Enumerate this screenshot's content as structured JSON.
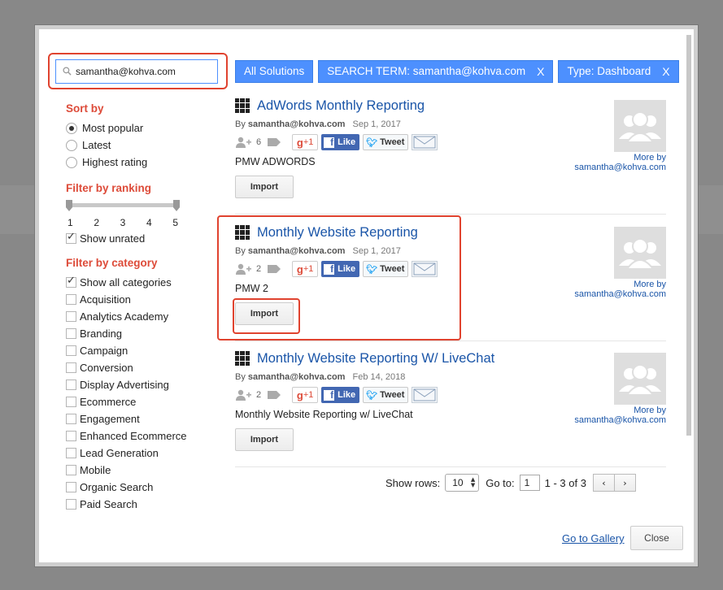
{
  "search": {
    "value": "samantha@kohva.com"
  },
  "sort": {
    "title": "Sort by",
    "options": [
      "Most popular",
      "Latest",
      "Highest rating"
    ],
    "selected": "Most popular"
  },
  "ranking": {
    "title": "Filter by ranking",
    "ticks": [
      "1",
      "2",
      "3",
      "4",
      "5"
    ],
    "show_unrated_label": "Show unrated",
    "show_unrated_checked": true
  },
  "category": {
    "title": "Filter by category",
    "show_all_label": "Show all categories",
    "show_all_checked": true,
    "items": [
      "Acquisition",
      "Analytics Academy",
      "Branding",
      "Campaign",
      "Conversion",
      "Display Advertising",
      "Ecommerce",
      "Engagement",
      "Enhanced Ecommerce",
      "Lead Generation",
      "Mobile",
      "Organic Search",
      "Paid Search"
    ]
  },
  "chips": [
    {
      "label": "All Solutions",
      "removable": false
    },
    {
      "label": "SEARCH TERM: samantha@kohva.com",
      "removable": true,
      "x": "X"
    },
    {
      "label": "Type: Dashboard",
      "removable": true,
      "x": "X"
    }
  ],
  "results": [
    {
      "title": "AdWords Monthly Reporting",
      "by_prefix": "By",
      "author": "samantha@kohva.com",
      "date": "Sep 1, 2017",
      "users": "6",
      "gplus": "+1",
      "fb_label": "Like",
      "tw_label": "Tweet",
      "description": "PMW ADWORDS",
      "import_label": "Import",
      "more_by_label": "More by",
      "more_by_author": "samantha@kohva.com"
    },
    {
      "title": "Monthly Website Reporting",
      "by_prefix": "By",
      "author": "samantha@kohva.com",
      "date": "Sep 1, 2017",
      "users": "2",
      "gplus": "+1",
      "fb_label": "Like",
      "tw_label": "Tweet",
      "description": "PMW 2",
      "import_label": "Import",
      "more_by_label": "More by",
      "more_by_author": "samantha@kohva.com"
    },
    {
      "title": "Monthly Website Reporting W/ LiveChat",
      "by_prefix": "By",
      "author": "samantha@kohva.com",
      "date": "Feb 14, 2018",
      "users": "2",
      "gplus": "+1",
      "fb_label": "Like",
      "tw_label": "Tweet",
      "description": "Monthly Website Reporting w/ LiveChat",
      "import_label": "Import",
      "more_by_label": "More by",
      "more_by_author": "samantha@kohva.com"
    }
  ],
  "pager": {
    "show_rows_label": "Show rows:",
    "rows_value": "10",
    "goto_label": "Go to:",
    "goto_value": "1",
    "range_text": "1 - 3 of 3",
    "prev": "‹",
    "next": "›"
  },
  "footer": {
    "gallery_link": "Go to Gallery",
    "close_label": "Close"
  },
  "colors": {
    "accent": "#4d90fe",
    "section_title": "#dd4b39",
    "link": "#1a55a8",
    "highlight": "#e0432f"
  }
}
